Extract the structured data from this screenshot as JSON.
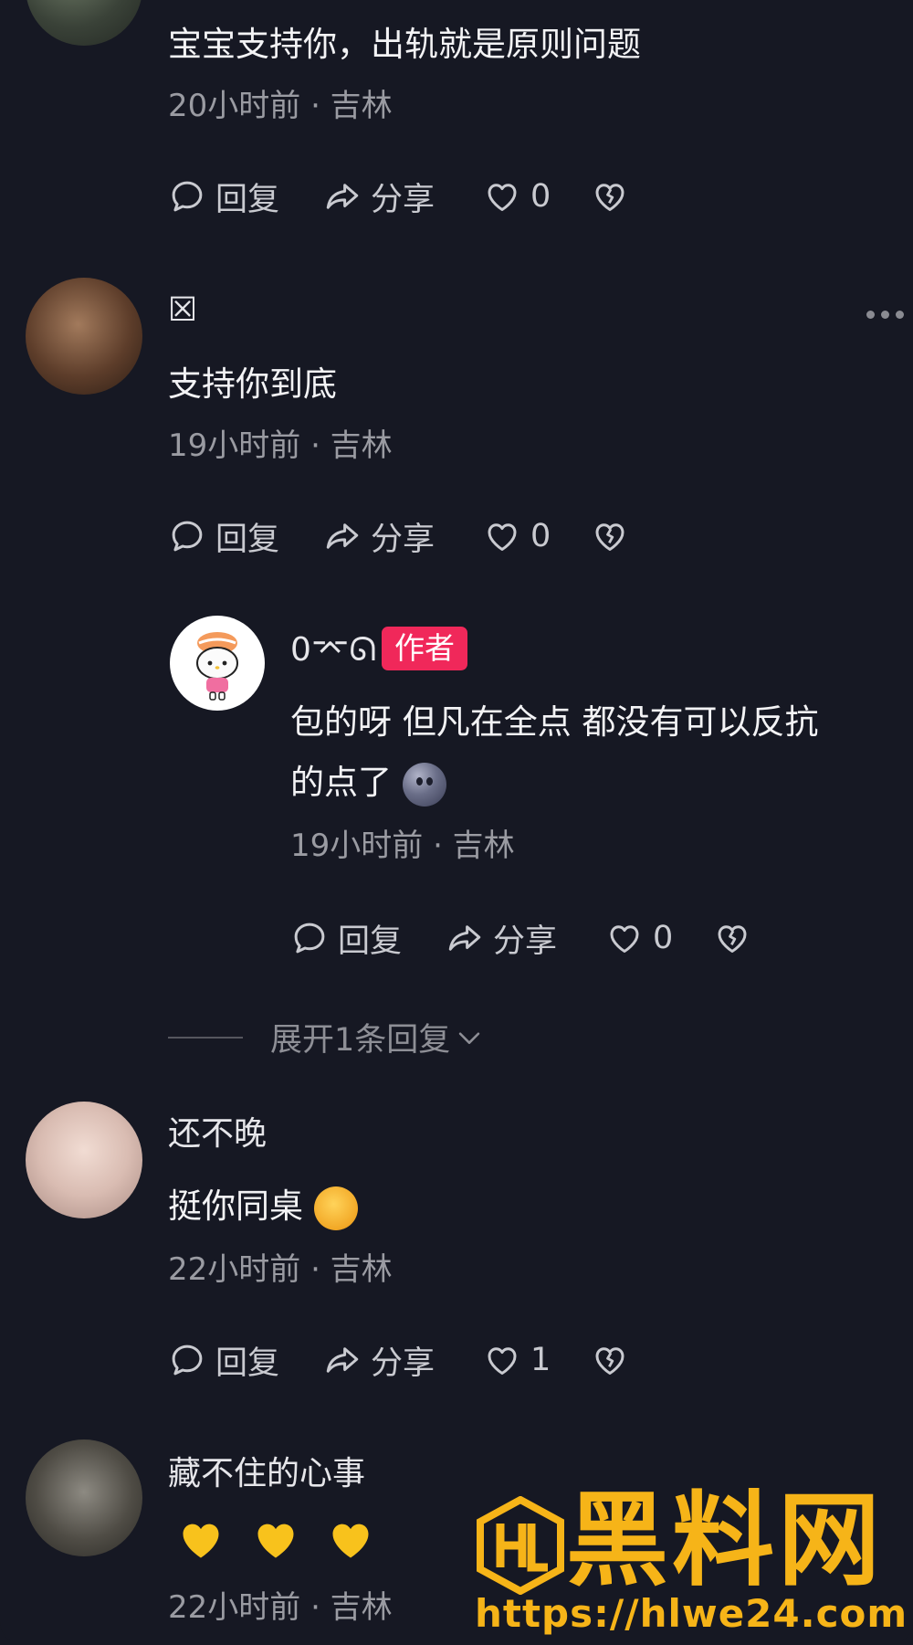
{
  "comments": [
    {
      "content": "宝宝支持你，出轨就是原则问题",
      "meta": "20小时前 · 吉林",
      "actions": {
        "reply": "回复",
        "share": "分享",
        "likes": "0"
      }
    },
    {
      "name": "☒",
      "content": "支持你到底",
      "meta": "19小时前 · 吉林",
      "actions": {
        "reply": "回复",
        "share": "分享",
        "likes": "0"
      }
    },
    {
      "name": "0⌤ᘏ",
      "badge": "作者",
      "content_line1": "包的呀 但凡在全点 都没有可以反抗",
      "content_line2": "的点了",
      "meta": "19小时前 · 吉林",
      "actions": {
        "reply": "回复",
        "share": "分享",
        "likes": "0"
      }
    },
    {
      "name": "还不晚",
      "content": "挺你同桌",
      "meta": "22小时前 · 吉林",
      "actions": {
        "reply": "回复",
        "share": "分享",
        "likes": "1"
      }
    },
    {
      "name": "藏不住的心事",
      "meta": "22小时前 · 吉林"
    }
  ],
  "expand_replies": "展开1条回复",
  "watermark": {
    "title": "黑料网",
    "url": "https://hlwe24.com"
  },
  "colors": {
    "background": "#161823",
    "author_badge": "#f0285a",
    "watermark": "#f6b418"
  },
  "icons": [
    "comment-bubble-icon",
    "share-arrow-icon",
    "heart-outline-icon",
    "broken-heart-icon",
    "more-dots-icon",
    "chevron-down-icon",
    "yellow-heart-emoji"
  ]
}
